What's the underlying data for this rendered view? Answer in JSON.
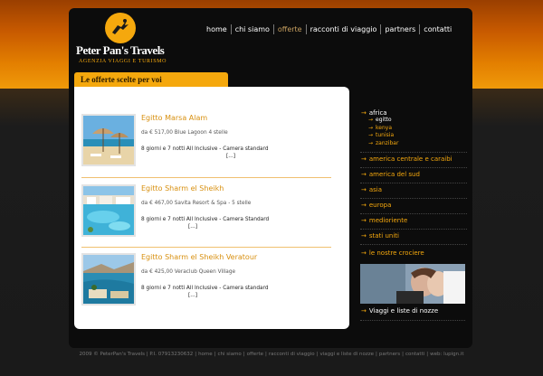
{
  "brand": {
    "name": "Peter Pan's Travels",
    "tagline": "AGENZIA VIAGGI E TURISMO"
  },
  "nav": [
    {
      "label": "home",
      "active": false
    },
    {
      "label": "chi siamo",
      "active": false
    },
    {
      "label": "offerte",
      "active": true
    },
    {
      "label": "racconti di viaggio",
      "active": false
    },
    {
      "label": "partners",
      "active": false
    },
    {
      "label": "contatti",
      "active": false
    }
  ],
  "section_title": "Le offerte scelte per voi",
  "offers": [
    {
      "title": "Egitto Marsa Alam",
      "price": "da € 517,00 Blue Lagoon 4 stelle",
      "desc": "8 giorni e 7 notti All Inclusive - Camera standard",
      "more": "[...]",
      "thumb": "beach-umbrellas"
    },
    {
      "title": "Egitto Sharm el Sheikh",
      "price": "da € 467,00 Savita Resort & Spa - 5 stelle",
      "desc": "8 giorni e 7 notti All Inclusive - Camera Standard",
      "more": "[...]",
      "thumb": "resort-pool"
    },
    {
      "title": "Egitto Sharm el Sheikh Veratour",
      "price": "da € 425,00 Veraclub Queen Village",
      "desc": "8 giorni e 7 notti All Inclusive - Camera standard",
      "more": "[...]",
      "thumb": "coastline"
    }
  ],
  "sidebar": {
    "africa": {
      "label": "africa",
      "subs": [
        {
          "label": "egitto",
          "selected": true
        },
        {
          "label": "kenya",
          "selected": false
        },
        {
          "label": "tunisia",
          "selected": false
        },
        {
          "label": "zanzibar",
          "selected": false
        }
      ]
    },
    "regions": [
      "america centrale e caraibi",
      "america del sud",
      "asia",
      "europa",
      "medioriente",
      "stati uniti"
    ],
    "crociere": "le nostre crociere",
    "promo_label": "Viaggi e liste di nozze"
  },
  "footer": {
    "copyright": "2009 © PeterPan's Travels | P.I. 07913230632",
    "links": [
      "home",
      "chi siamo",
      "offerte",
      "racconti di viaggio",
      "viaggi e liste di nozze",
      "partners",
      "contatti"
    ],
    "web": "web: lupign.it"
  },
  "colors": {
    "accent": "#f5a80d",
    "background_top": "#e37f00",
    "panel": "#0c0c0c"
  }
}
